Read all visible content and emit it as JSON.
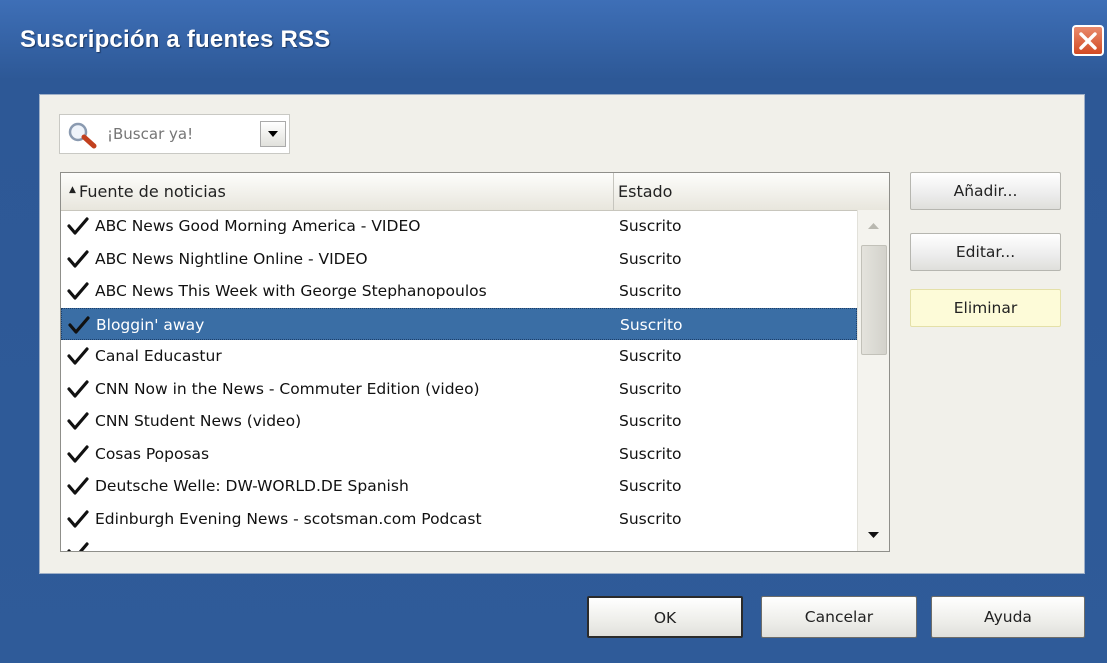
{
  "window": {
    "title": "Suscripción a fuentes RSS"
  },
  "search": {
    "placeholder": "¡Buscar ya!"
  },
  "list": {
    "columns": {
      "name": "Fuente de noticias",
      "status": "Estado"
    },
    "rows": [
      {
        "name": "ABC News Good Morning America - VIDEO",
        "status": "Suscrito",
        "checked": true,
        "selected": false
      },
      {
        "name": "ABC News Nightline Online - VIDEO",
        "status": "Suscrito",
        "checked": true,
        "selected": false
      },
      {
        "name": "ABC News This Week with George Stephanopoulos",
        "status": "Suscrito",
        "checked": true,
        "selected": false
      },
      {
        "name": "Bloggin' away",
        "status": "Suscrito",
        "checked": true,
        "selected": true
      },
      {
        "name": "Canal Educastur",
        "status": "Suscrito",
        "checked": true,
        "selected": false
      },
      {
        "name": "CNN Now in the News - Commuter Edition (video)",
        "status": "Suscrito",
        "checked": true,
        "selected": false
      },
      {
        "name": "CNN Student News (video)",
        "status": "Suscrito",
        "checked": true,
        "selected": false
      },
      {
        "name": "Cosas Poposas",
        "status": "Suscrito",
        "checked": true,
        "selected": false
      },
      {
        "name": "Deutsche Welle: DW-WORLD.DE Spanish",
        "status": "Suscrito",
        "checked": true,
        "selected": false
      },
      {
        "name": "Edinburgh Evening News - scotsman.com Podcast",
        "status": "Suscrito",
        "checked": true,
        "selected": false
      }
    ]
  },
  "side_buttons": {
    "add": "Añadir...",
    "edit": "Editar...",
    "remove": "Eliminar"
  },
  "footer_buttons": {
    "ok": "OK",
    "cancel": "Cancelar",
    "help": "Ayuda"
  },
  "icons": {
    "search": "magnifier-icon",
    "dropdown": "chevron-down-icon",
    "close": "close-icon",
    "check": "checkmark-icon"
  },
  "colors": {
    "title_bar": "#3e6fb7",
    "selection": "#3a6ea5",
    "close_button": "#d24a24",
    "active_button": "#fdfbd8"
  }
}
